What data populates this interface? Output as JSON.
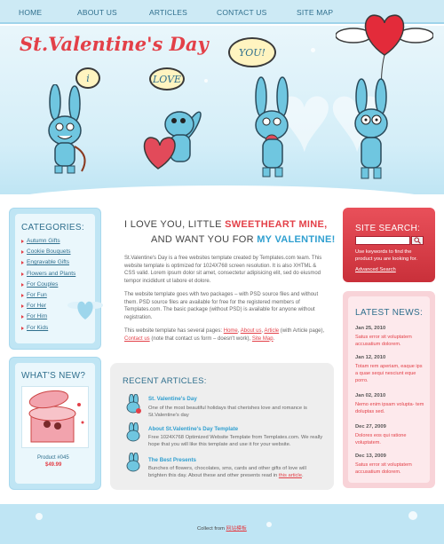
{
  "nav": {
    "home": "HOME",
    "about": "ABOUT US",
    "articles": "ARTICLES",
    "contact": "CONTACT US",
    "sitemap": "SITE MAP"
  },
  "header": {
    "logo_text": "St.Valentine's Day",
    "bubble_i": "i",
    "bubble_love": "LOVE",
    "bubble_you": "YOU!"
  },
  "categories": {
    "title": "CATEGORIES:",
    "items": [
      "Autumn Gifts",
      "Cookie Bouquets",
      "Engravable Gifts",
      "Flowers and Plants",
      "For Couples",
      "For Fun",
      "For Her",
      "For Him",
      "For Kids"
    ]
  },
  "whats_new": {
    "title": "WHAT'S NEW?",
    "product_name": "Product #045",
    "price": "$49.99"
  },
  "intro": {
    "line1_prefix": "I LOVE YOU, LITTLE ",
    "line1_highlight": "SWEETHEART MINE,",
    "line2_prefix": "AND WANT YOU FOR ",
    "line2_highlight": "MY VALENTINE!",
    "p1": "St.Valentine's Day is a free websites template created by Templates.com team. This website template is optimized for 1024X768 screen resolution. It is also XHTML & CSS valid. Lorem ipsum dolor sit amet, consectetur adipisicing elit, sed do eiusmod tempor incididunt ut labore et dolore.",
    "p2": "The website template goes with two packages – with PSD source files and without them. PSD source files are available for free for the registered members of Templates.com. The basic package (without PSD) is available for anyone without registration.",
    "p3_a": "This website template has several pages: ",
    "p3_link1": "Home",
    "p3_sep1": ", ",
    "p3_link2": "About us",
    "p3_sep2": ", ",
    "p3_link3": "Article",
    "p3_b": " (with Article page), ",
    "p3_link4": "Contact us",
    "p3_c": " (note that contact us form – doesn't work), ",
    "p3_link5": "Site Map",
    "p3_d": "."
  },
  "recent_articles": {
    "title": "RECENT ARTICLES:",
    "items": [
      {
        "title": "St. Valentine's Day",
        "text": "One of the most beautiful holidays that cherishes love and romance is St.Valentine's day"
      },
      {
        "title": "About St.Valentine's Day Template",
        "text": "Free 1024X768 Optimized Website Template from Templates.com. We really hope that you will like this template and use it for your website."
      },
      {
        "title": "The Best Presents",
        "text": "Bunches of flowers, chocolates, sms, cards and other gifts of love will brighten this day. About these and other presents read in ",
        "link": "this article",
        "end": "."
      }
    ]
  },
  "site_search": {
    "title": "SITE SEARCH:",
    "hint": "Use keywords to find the product you are looking for.",
    "advanced": "Advanced Search"
  },
  "latest_news": {
    "title": "LATEST NEWS:",
    "items": [
      {
        "date": "Jan 25, 2010",
        "text": "Satus error sit voluptatem accusatium dolorem."
      },
      {
        "date": "Jan 12, 2010",
        "text": "Totam rem aperiam, eaque ips a quae sequi nesciunt eque porro."
      },
      {
        "date": "Jan 02, 2010",
        "text": "Nemo enim ipsam volupta- tem doluptas sed."
      },
      {
        "date": "Dec 27, 2009",
        "text": "Dolores eos qui ratione voluptatem."
      },
      {
        "date": "Dec 13, 2009",
        "text": "Satus error sit voluptatem accusatium dolorem."
      }
    ]
  },
  "footer": {
    "prefix": "Collect from ",
    "link": "网站模板"
  },
  "colors": {
    "accent_red": "#e34048",
    "accent_blue": "#2f6f8d",
    "light_blue": "#bfe5f4"
  }
}
